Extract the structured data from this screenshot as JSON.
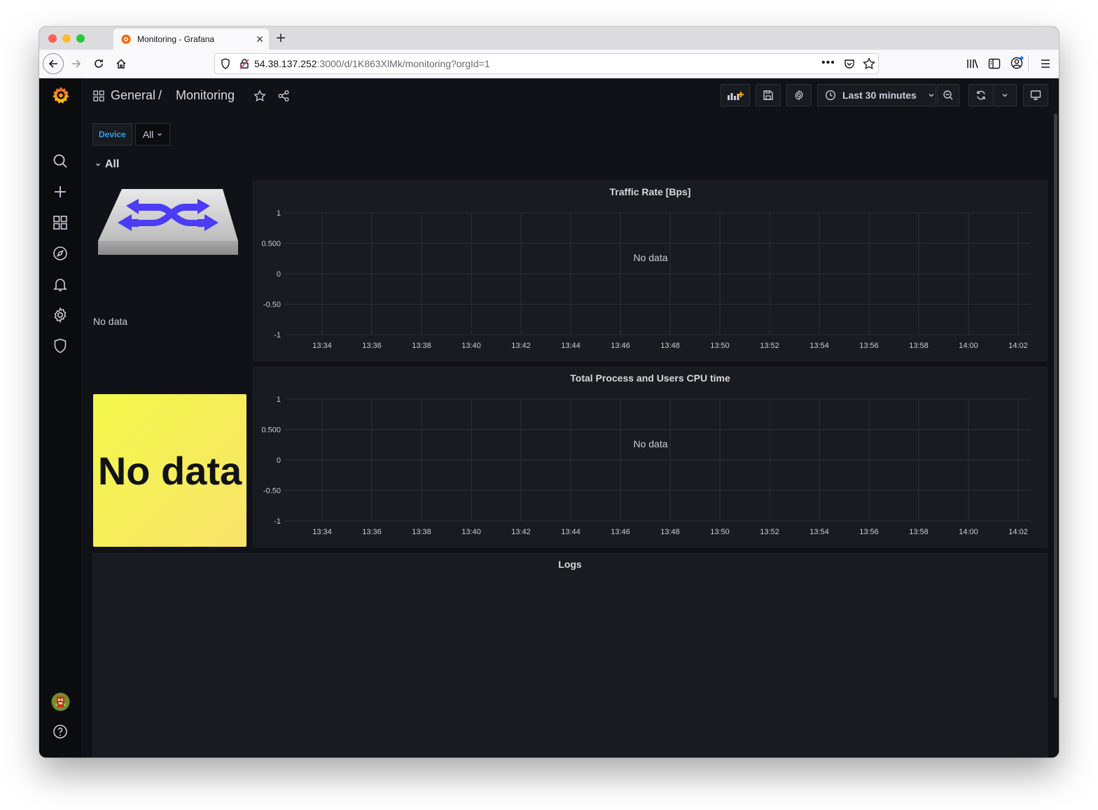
{
  "browser": {
    "tab_title": "Monitoring - Grafana",
    "url_host": "54.38.137.252",
    "url_path": ":3000/d/1K863XlMk/monitoring?orgId=1"
  },
  "breadcrumb": {
    "folder": "General",
    "separator": "/",
    "dashboard": "Monitoring"
  },
  "toolbar": {
    "time_range": "Last 30 minutes"
  },
  "variables": {
    "label": "Device",
    "value": "All"
  },
  "row": {
    "title": "All"
  },
  "image_panel": {
    "no_data": "No data"
  },
  "stat_panel": {
    "value": "No data"
  },
  "logs_panel": {
    "title": "Logs"
  },
  "colors": {
    "stat_gradient_start": "#f2f84a",
    "stat_gradient_end": "#f9e36a",
    "variable_label": "#33a2e5",
    "background": "#111217"
  },
  "chart_data": [
    {
      "type": "line",
      "title": "Traffic Rate [Bps]",
      "message": "No data",
      "x": [
        "13:34",
        "13:36",
        "13:38",
        "13:40",
        "13:42",
        "13:44",
        "13:46",
        "13:48",
        "13:50",
        "13:52",
        "13:54",
        "13:56",
        "13:58",
        "14:00",
        "14:02"
      ],
      "y_ticks": [
        "1",
        "0.500",
        "0",
        "-0.50",
        "-1"
      ],
      "ylim": [
        -1,
        1
      ],
      "series": [],
      "grid": true
    },
    {
      "type": "line",
      "title": "Total Process and Users CPU time",
      "message": "No data",
      "x": [
        "13:34",
        "13:36",
        "13:38",
        "13:40",
        "13:42",
        "13:44",
        "13:46",
        "13:48",
        "13:50",
        "13:52",
        "13:54",
        "13:56",
        "13:58",
        "14:00",
        "14:02"
      ],
      "y_ticks": [
        "1",
        "0.500",
        "0",
        "-0.50",
        "-1"
      ],
      "ylim": [
        -1,
        1
      ],
      "series": [],
      "grid": true
    }
  ]
}
